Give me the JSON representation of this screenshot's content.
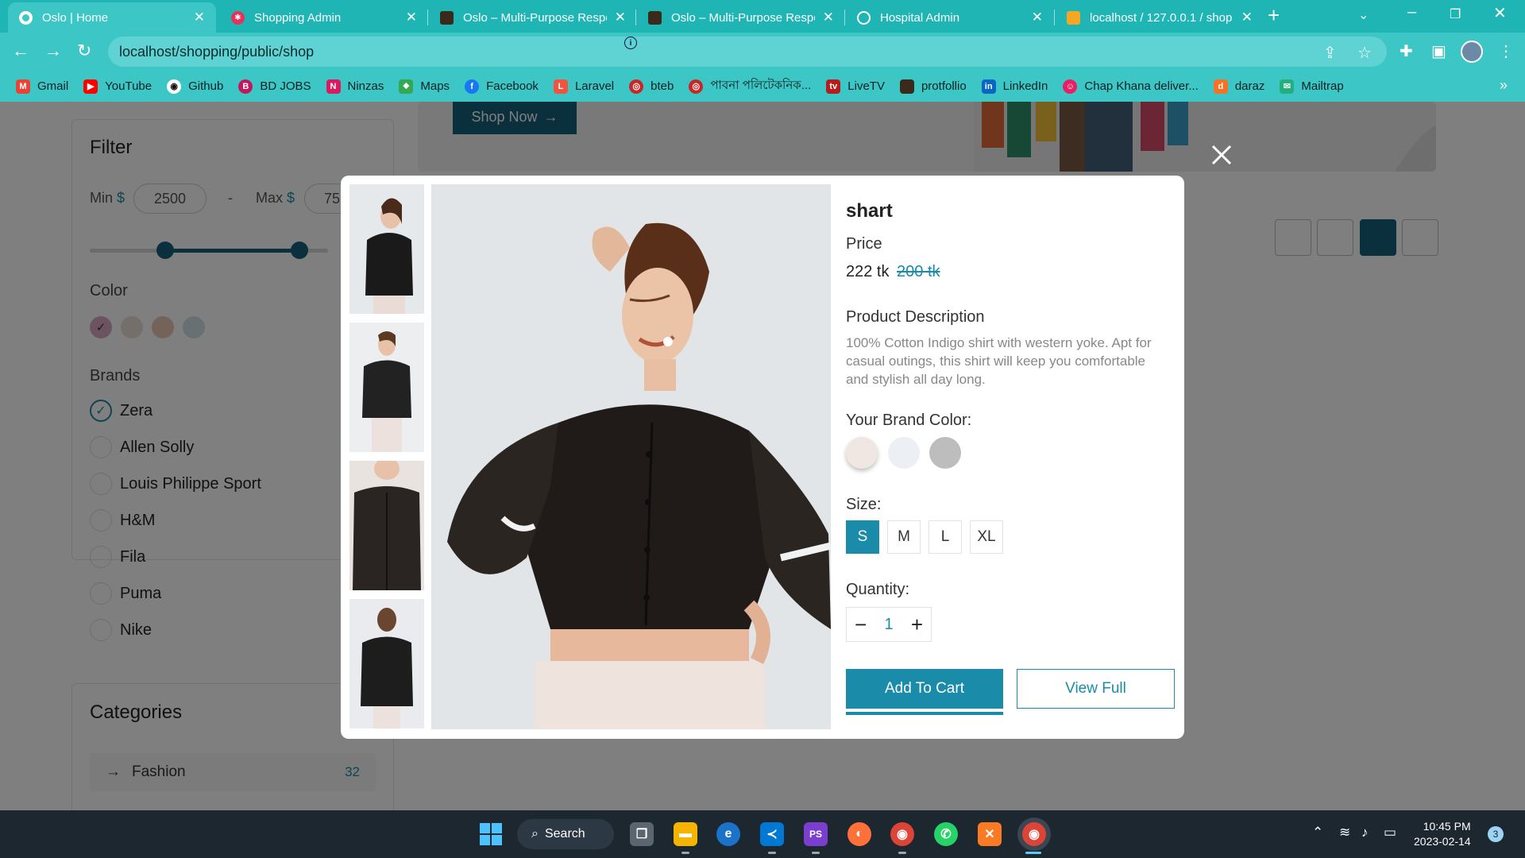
{
  "browser": {
    "tabs": [
      {
        "title": "Oslo | Home",
        "active": true
      },
      {
        "title": "Shopping Admin",
        "active": false
      },
      {
        "title": "Oslo – Multi-Purpose Respo",
        "active": false
      },
      {
        "title": "Oslo – Multi-Purpose Respo",
        "active": false
      },
      {
        "title": "Hospital Admin",
        "active": false
      },
      {
        "title": "localhost / 127.0.0.1 / shop",
        "active": false
      }
    ],
    "url": "localhost/shopping/public/shop",
    "bookmarks": [
      "Gmail",
      "YouTube",
      "Github",
      "BD JOBS",
      "Ninzas",
      "Maps",
      "Facebook",
      "Laravel",
      "bteb",
      "পাবনা পলিটেকনিক...",
      "LiveTV",
      "protfollio",
      "LinkedIn",
      "Chap Khana deliver...",
      "daraz",
      "Mailtrap"
    ]
  },
  "shop": {
    "hero_button": "Shop Now",
    "filter": {
      "title": "Filter",
      "min_label": "Min",
      "max_label": "Max",
      "currency": "$",
      "min_value": "2500",
      "max_value": "75",
      "dash": "-"
    },
    "color_title": "Color",
    "colors": [
      "#d9a7c0",
      "#eadfd6",
      "#e6c7b7",
      "#cfe1e6"
    ],
    "brands_title": "Brands",
    "brands": [
      {
        "name": "Zera",
        "checked": true
      },
      {
        "name": "Allen Solly",
        "checked": false
      },
      {
        "name": "Louis Philippe Sport",
        "checked": false
      },
      {
        "name": "H&M",
        "checked": false
      },
      {
        "name": "Fila",
        "checked": false
      },
      {
        "name": "Puma",
        "checked": false
      },
      {
        "name": "Nike",
        "checked": false
      }
    ],
    "categories_title": "Categories",
    "categories": [
      {
        "name": "Fashion",
        "count": "32"
      }
    ]
  },
  "modal": {
    "product_name": "shart",
    "price_label": "Price",
    "price": "222 tk",
    "old_price": "200 tk",
    "description_title": "Product Description",
    "description": "100% Cotton Indigo shirt with western yoke. Apt for casual outings, this shirt will keep you comfortable and stylish all day long.",
    "brand_color_title": "Your Brand Color:",
    "brand_colors": [
      "#f0e6e2",
      "#eceff4",
      "#bdbdbd"
    ],
    "size_title": "Size:",
    "sizes": [
      "S",
      "M",
      "L",
      "XL"
    ],
    "selected_size": "S",
    "quantity_title": "Quantity:",
    "quantity": "1",
    "add_to_cart": "Add To Cart",
    "view_full": "View Full"
  },
  "taskbar": {
    "search": "Search",
    "time": "10:45 PM",
    "date": "2023-02-14",
    "notifications": "3"
  },
  "colors": {
    "accent": "#1a8ba8",
    "chrome": "#3cc6c6",
    "taskbar": "#1d2730"
  }
}
